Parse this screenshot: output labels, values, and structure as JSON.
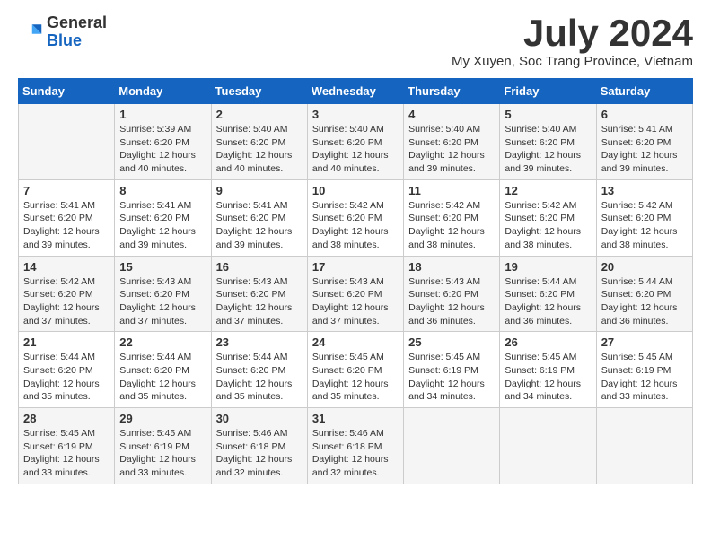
{
  "header": {
    "logo_line1": "General",
    "logo_line2": "Blue",
    "main_title": "July 2024",
    "subtitle": "My Xuyen, Soc Trang Province, Vietnam"
  },
  "columns": [
    "Sunday",
    "Monday",
    "Tuesday",
    "Wednesday",
    "Thursday",
    "Friday",
    "Saturday"
  ],
  "weeks": [
    [
      {
        "day": "",
        "info": ""
      },
      {
        "day": "1",
        "info": "Sunrise: 5:39 AM\nSunset: 6:20 PM\nDaylight: 12 hours\nand 40 minutes."
      },
      {
        "day": "2",
        "info": "Sunrise: 5:40 AM\nSunset: 6:20 PM\nDaylight: 12 hours\nand 40 minutes."
      },
      {
        "day": "3",
        "info": "Sunrise: 5:40 AM\nSunset: 6:20 PM\nDaylight: 12 hours\nand 40 minutes."
      },
      {
        "day": "4",
        "info": "Sunrise: 5:40 AM\nSunset: 6:20 PM\nDaylight: 12 hours\nand 39 minutes."
      },
      {
        "day": "5",
        "info": "Sunrise: 5:40 AM\nSunset: 6:20 PM\nDaylight: 12 hours\nand 39 minutes."
      },
      {
        "day": "6",
        "info": "Sunrise: 5:41 AM\nSunset: 6:20 PM\nDaylight: 12 hours\nand 39 minutes."
      }
    ],
    [
      {
        "day": "7",
        "info": "Sunrise: 5:41 AM\nSunset: 6:20 PM\nDaylight: 12 hours\nand 39 minutes."
      },
      {
        "day": "8",
        "info": "Sunrise: 5:41 AM\nSunset: 6:20 PM\nDaylight: 12 hours\nand 39 minutes."
      },
      {
        "day": "9",
        "info": "Sunrise: 5:41 AM\nSunset: 6:20 PM\nDaylight: 12 hours\nand 39 minutes."
      },
      {
        "day": "10",
        "info": "Sunrise: 5:42 AM\nSunset: 6:20 PM\nDaylight: 12 hours\nand 38 minutes."
      },
      {
        "day": "11",
        "info": "Sunrise: 5:42 AM\nSunset: 6:20 PM\nDaylight: 12 hours\nand 38 minutes."
      },
      {
        "day": "12",
        "info": "Sunrise: 5:42 AM\nSunset: 6:20 PM\nDaylight: 12 hours\nand 38 minutes."
      },
      {
        "day": "13",
        "info": "Sunrise: 5:42 AM\nSunset: 6:20 PM\nDaylight: 12 hours\nand 38 minutes."
      }
    ],
    [
      {
        "day": "14",
        "info": "Sunrise: 5:42 AM\nSunset: 6:20 PM\nDaylight: 12 hours\nand 37 minutes."
      },
      {
        "day": "15",
        "info": "Sunrise: 5:43 AM\nSunset: 6:20 PM\nDaylight: 12 hours\nand 37 minutes."
      },
      {
        "day": "16",
        "info": "Sunrise: 5:43 AM\nSunset: 6:20 PM\nDaylight: 12 hours\nand 37 minutes."
      },
      {
        "day": "17",
        "info": "Sunrise: 5:43 AM\nSunset: 6:20 PM\nDaylight: 12 hours\nand 37 minutes."
      },
      {
        "day": "18",
        "info": "Sunrise: 5:43 AM\nSunset: 6:20 PM\nDaylight: 12 hours\nand 36 minutes."
      },
      {
        "day": "19",
        "info": "Sunrise: 5:44 AM\nSunset: 6:20 PM\nDaylight: 12 hours\nand 36 minutes."
      },
      {
        "day": "20",
        "info": "Sunrise: 5:44 AM\nSunset: 6:20 PM\nDaylight: 12 hours\nand 36 minutes."
      }
    ],
    [
      {
        "day": "21",
        "info": "Sunrise: 5:44 AM\nSunset: 6:20 PM\nDaylight: 12 hours\nand 35 minutes."
      },
      {
        "day": "22",
        "info": "Sunrise: 5:44 AM\nSunset: 6:20 PM\nDaylight: 12 hours\nand 35 minutes."
      },
      {
        "day": "23",
        "info": "Sunrise: 5:44 AM\nSunset: 6:20 PM\nDaylight: 12 hours\nand 35 minutes."
      },
      {
        "day": "24",
        "info": "Sunrise: 5:45 AM\nSunset: 6:20 PM\nDaylight: 12 hours\nand 35 minutes."
      },
      {
        "day": "25",
        "info": "Sunrise: 5:45 AM\nSunset: 6:19 PM\nDaylight: 12 hours\nand 34 minutes."
      },
      {
        "day": "26",
        "info": "Sunrise: 5:45 AM\nSunset: 6:19 PM\nDaylight: 12 hours\nand 34 minutes."
      },
      {
        "day": "27",
        "info": "Sunrise: 5:45 AM\nSunset: 6:19 PM\nDaylight: 12 hours\nand 33 minutes."
      }
    ],
    [
      {
        "day": "28",
        "info": "Sunrise: 5:45 AM\nSunset: 6:19 PM\nDaylight: 12 hours\nand 33 minutes."
      },
      {
        "day": "29",
        "info": "Sunrise: 5:45 AM\nSunset: 6:19 PM\nDaylight: 12 hours\nand 33 minutes."
      },
      {
        "day": "30",
        "info": "Sunrise: 5:46 AM\nSunset: 6:18 PM\nDaylight: 12 hours\nand 32 minutes."
      },
      {
        "day": "31",
        "info": "Sunrise: 5:46 AM\nSunset: 6:18 PM\nDaylight: 12 hours\nand 32 minutes."
      },
      {
        "day": "",
        "info": ""
      },
      {
        "day": "",
        "info": ""
      },
      {
        "day": "",
        "info": ""
      }
    ]
  ]
}
